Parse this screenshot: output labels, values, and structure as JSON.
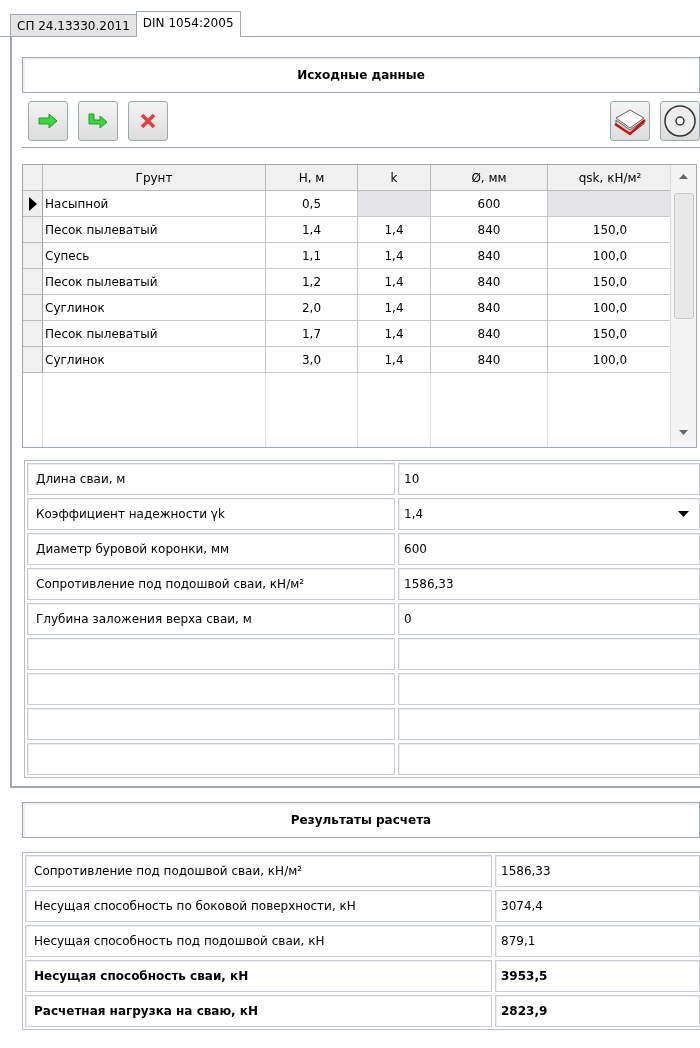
{
  "tabs": [
    {
      "label": "СП 24.13330.2011",
      "selected": false
    },
    {
      "label": "DIN 1054:2005",
      "selected": true
    }
  ],
  "input_section": {
    "title": "Исходные данные"
  },
  "soil_table": {
    "columns": [
      "Грунт",
      "H, м",
      "k",
      "Ø, мм",
      "qsk, кН/м²"
    ],
    "rows": [
      {
        "soil": "Насыпной",
        "h": "0,5",
        "diameter": "600",
        "selected": true
      },
      {
        "soil": "Песок пылеватый",
        "h": "1,4",
        "k": "1,4",
        "diameter": "840",
        "qsk": "150,0",
        "selected": false
      },
      {
        "soil": "Супесь",
        "h": "1,1",
        "k": "1,4",
        "diameter": "840",
        "qsk": "100,0",
        "selected": false
      },
      {
        "soil": "Песок пылеватый",
        "h": "1,2",
        "k": "1,4",
        "diameter": "840",
        "qsk": "150,0",
        "selected": false
      },
      {
        "soil": "Суглинок",
        "h": "2,0",
        "k": "1,4",
        "diameter": "840",
        "qsk": "100,0",
        "selected": false
      },
      {
        "soil": "Песок пылеватый",
        "h": "1,7",
        "k": "1,4",
        "diameter": "840",
        "qsk": "150,0",
        "selected": false
      },
      {
        "soil": "Суглинок",
        "h": "3,0",
        "k": "1,4",
        "diameter": "840",
        "qsk": "100,0",
        "selected": false
      }
    ]
  },
  "parameters": [
    {
      "label": "Длина сваи, м",
      "value": "10",
      "kind": "text"
    },
    {
      "label": "Коэффициент надежности γk",
      "value": "1,4",
      "kind": "dropdown"
    },
    {
      "label": "Диаметр буровой коронки, мм",
      "value": "600",
      "kind": "text"
    },
    {
      "label": "Сопротивление под подошвой сваи, кН/м²",
      "value": "1586,33",
      "kind": "text"
    },
    {
      "label": "Глубина заложения верха сваи, м",
      "value": "0",
      "kind": "text"
    }
  ],
  "results_section": {
    "title": "Результаты расчета"
  },
  "results": [
    {
      "label": "Сопротивление под подошвой сваи, кН/м²",
      "value": "1586,33",
      "bold": false
    },
    {
      "label": "Несущая способность по боковой поверхности, кН",
      "value": "3074,4",
      "bold": false
    },
    {
      "label": "Несущая способность под подошвой сваи, кН",
      "value": " 879,1",
      "bold": false
    },
    {
      "label": "Несущая способность сваи, кН",
      "value": "3953,5",
      "bold": true
    },
    {
      "label": "Расчетная нагрузка на сваю, кН",
      "value": "2823,9",
      "bold": true
    }
  ]
}
